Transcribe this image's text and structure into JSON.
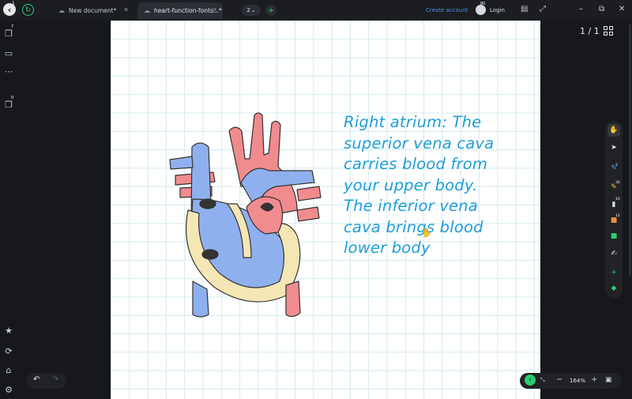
{
  "topbar": {
    "home_badge": "1",
    "tabs": [
      {
        "label": "New document*"
      },
      {
        "label": "heart-function-fonts...*"
      }
    ],
    "pages_count": "2",
    "create_account": "Create account",
    "user_badge": "80",
    "login": "Login"
  },
  "sidebar": {
    "badge_1": "7",
    "badge_2": "0"
  },
  "canvas": {
    "note_text": "Right atrium: The\nsuperior vena cava\ncarries blood from\nyour upper body.\nThe inferior vena\ncava brings blood\nlower body",
    "note_color": "#1f9ed8"
  },
  "page_indicator": "1 / 1",
  "tools": {
    "pen_badge": "2",
    "highlighter_badge": "30",
    "eraser_badge": "10",
    "shapes_badge": "12"
  },
  "zoom": {
    "level": "164%"
  },
  "colors": {
    "accent_green": "#2ecc71",
    "link_blue": "#4a8de6",
    "artery_red": "#f08b8e",
    "vein_blue": "#8fb0ef"
  }
}
